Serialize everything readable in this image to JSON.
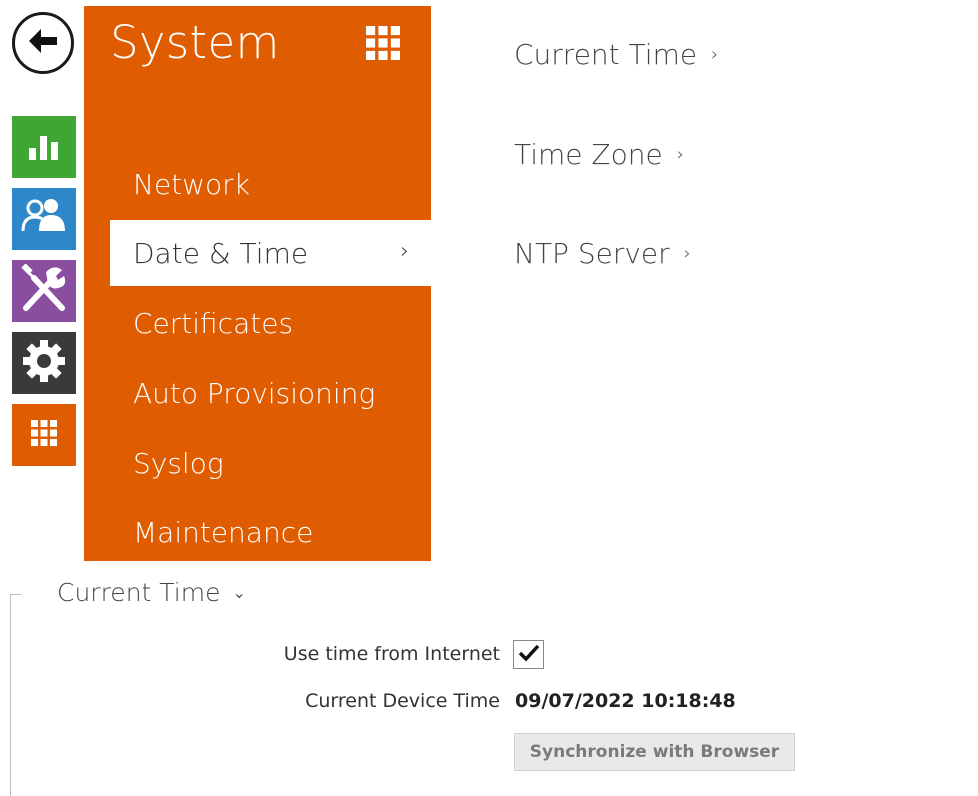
{
  "nav": {
    "back_icon": "arrow-left-icon",
    "rail": [
      {
        "icon": "bar-chart-icon",
        "color": "#3fa535"
      },
      {
        "icon": "users-icon",
        "color": "#2d87c8"
      },
      {
        "icon": "tools-icon",
        "color": "#8a4ea0"
      },
      {
        "icon": "gear-icon",
        "color": "#3a3a3a"
      },
      {
        "icon": "grid-icon",
        "color": "#e05c00"
      }
    ]
  },
  "system_panel": {
    "title": "System",
    "accent_color": "#e05c00",
    "menu": [
      {
        "label": "Network"
      },
      {
        "label": "Date & Time",
        "active": true
      },
      {
        "label": "Certificates"
      },
      {
        "label": "Auto Provisioning"
      },
      {
        "label": "Syslog"
      },
      {
        "label": "Maintenance"
      }
    ]
  },
  "sections": [
    {
      "label": "Current Time"
    },
    {
      "label": "Time Zone"
    },
    {
      "label": "NTP Server"
    }
  ],
  "current_time": {
    "title": "Current Time",
    "use_internet_label": "Use time from Internet",
    "use_internet_checked": true,
    "device_time_label": "Current Device Time",
    "device_time_value": "09/07/2022 10:18:48",
    "sync_button": "Synchronize with Browser"
  }
}
